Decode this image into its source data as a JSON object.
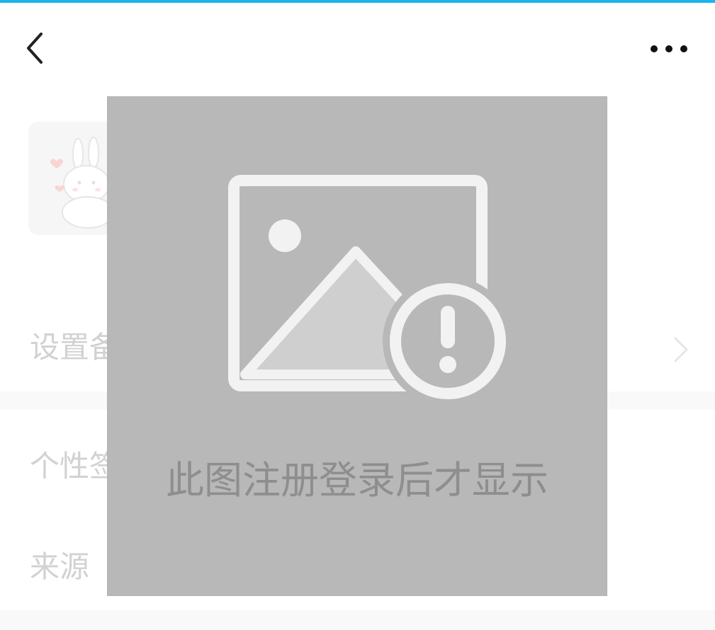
{
  "theme": {
    "accent": "#1cb4ea",
    "overlay_bg": "#b8b8b8",
    "overlay_text": "#8e8e8e",
    "row_text": "#d2d2d2"
  },
  "navbar": {
    "back_icon": "chevron-left-icon",
    "more_icon": "more-horizontal-icon"
  },
  "profile": {
    "avatar_icon": "rabbit-avatar"
  },
  "rows": [
    {
      "label": "设置备",
      "has_chevron": true
    },
    {
      "label": "个性签",
      "has_chevron": false
    },
    {
      "label": "来源",
      "has_chevron": false
    }
  ],
  "overlay": {
    "icon": "image-error-icon",
    "message": "此图注册登录后才显示"
  }
}
